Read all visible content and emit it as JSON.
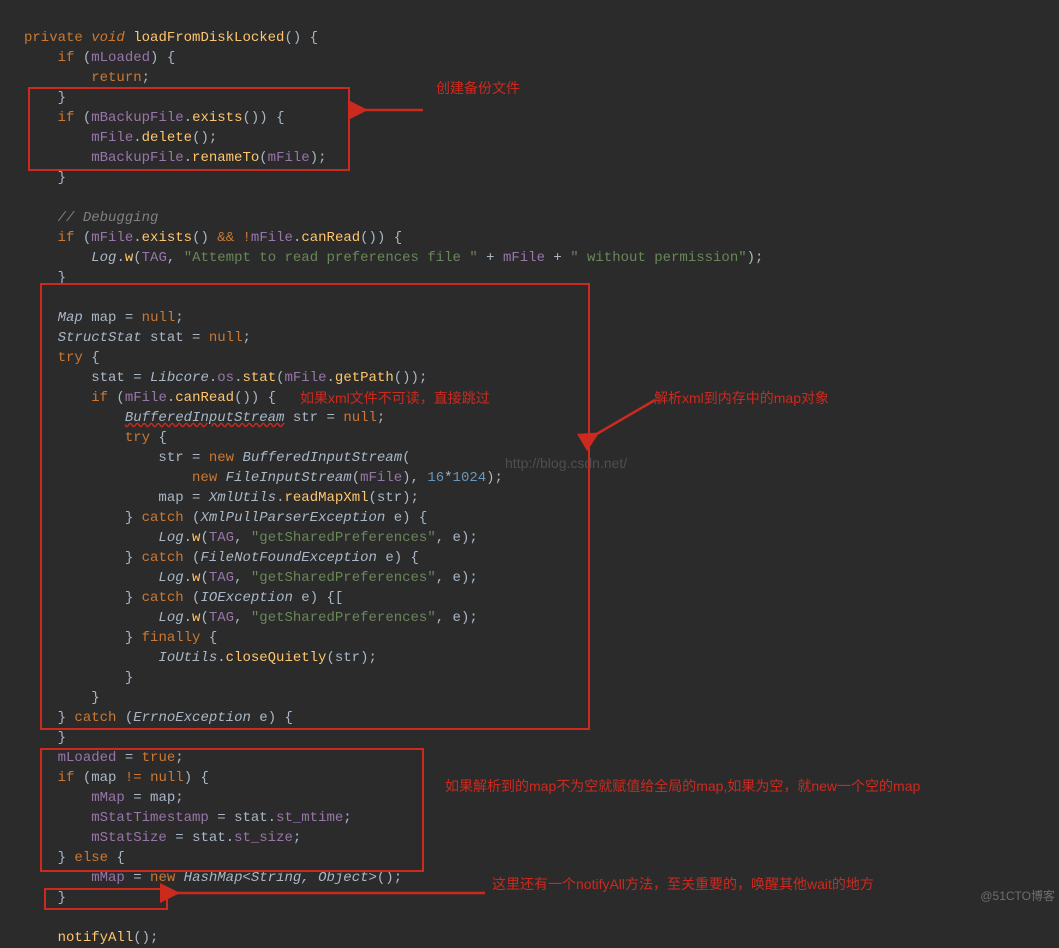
{
  "code": {
    "l01": {
      "kw1": "private",
      "kw2": "void",
      "mth": "loadFromDiskLocked",
      "rest": "() {"
    },
    "l02": {
      "kw": "if",
      "fld": "mLoaded",
      "rest1": " (",
      "rest2": ") {"
    },
    "l03": {
      "kw": "return",
      "rest": ";"
    },
    "l04": {
      "rest": "}"
    },
    "l05": {
      "kw": "if",
      "fld": "mBackupFile",
      "mth": "exists",
      "rest1": " (",
      "rest2": ".",
      "rest3": "()) {"
    },
    "l06": {
      "fld": "mFile",
      "mth": "delete",
      "rest1": ".",
      "rest2": "();"
    },
    "l07": {
      "fld": "mBackupFile",
      "mth": "renameTo",
      "fld2": "mFile",
      "r1": ".",
      "r2": "(",
      "r3": ");"
    },
    "l08": {
      "rest": "}"
    },
    "l09": "",
    "l10": {
      "com": "// Debugging"
    },
    "l11": {
      "kw": "if",
      "fld1": "mFile",
      "mth1": "exists",
      "op": "&&",
      "not": "!",
      "fld2": "mFile",
      "mth2": "canRead",
      "r1": " (",
      "r2": ".",
      "r3": "() ",
      "r4": ".",
      "r5": "()) {"
    },
    "l12": {
      "cls": "Log",
      "mth": "w",
      "fld": "TAG",
      "str1": "\"Attempt to read preferences file \"",
      "fld2": "mFile",
      "str2": "\" without permission\"",
      "r1": ".",
      "r2": "(",
      "r3": ", ",
      "r4": " + ",
      "r5": " + ",
      "r6": ");"
    },
    "l13": {
      "rest": "}"
    },
    "l14": "",
    "l15": {
      "cls": "Map",
      "var": "map",
      "op": "= ",
      "null": "null",
      "rest": ";"
    },
    "l16": {
      "cls": "StructStat",
      "var": "stat",
      "op": "= ",
      "null": "null",
      "rest": ";"
    },
    "l17": {
      "kw": "try",
      "rest": " {"
    },
    "l18": {
      "var": "stat",
      "op": " = ",
      "cls": "Libcore",
      "fld": "os",
      "mth1": "stat",
      "fld2": "mFile",
      "mth2": "getPath",
      "r1": ".",
      "r2": ".",
      "r3": "(",
      "r4": ".",
      "r5": "());"
    },
    "l19": {
      "kw": "if",
      "fld": "mFile",
      "mth": "canRead",
      "r1": " (",
      "r2": ".",
      "r3": "()) {"
    },
    "l20": {
      "cls": "BufferedInputStream",
      "var": "str",
      "op": " = ",
      "null": "null",
      "rest": ";"
    },
    "l21": {
      "kw": "try",
      "rest": " {"
    },
    "l22": {
      "var": "str",
      "op": " = ",
      "kw": "new",
      "cls": "BufferedInputStream",
      "rest": "("
    },
    "l23": {
      "kw": "new",
      "cls": "FileInputStream",
      "fld": "mFile",
      "num1": "16",
      "num2": "1024",
      "r1": "(",
      "r2": "), ",
      "r3": "*",
      "r4": ");"
    },
    "l24": {
      "var": "map",
      "op": " = ",
      "cls": "XmlUtils",
      "mth": "readMapXml",
      "var2": "str",
      "r1": ".",
      "r2": "(",
      "r3": ");"
    },
    "l25": {
      "rest1": "} ",
      "kw": "catch",
      "cls": "XmlPullParserException",
      "var": "e",
      "r1": " (",
      "r2": " ",
      "r3": ") {"
    },
    "l26": {
      "cls": "Log",
      "mth": "w",
      "fld": "TAG",
      "str": "\"getSharedPreferences\"",
      "var": "e",
      "r1": ".",
      "r2": "(",
      "r3": ", ",
      "r4": ", ",
      "r5": ");"
    },
    "l27": {
      "rest1": "} ",
      "kw": "catch",
      "cls": "FileNotFoundException",
      "var": "e",
      "r1": " (",
      "r2": " ",
      "r3": ") {"
    },
    "l28": {
      "cls": "Log",
      "mth": "w",
      "fld": "TAG",
      "str": "\"getSharedPreferences\"",
      "var": "e",
      "r1": ".",
      "r2": "(",
      "r3": ", ",
      "r4": ", ",
      "r5": ");"
    },
    "l29": {
      "rest1": "} ",
      "kw": "catch",
      "cls": "IOException",
      "var": "e",
      "r1": " (",
      "r2": " ",
      "r3": ") {"
    },
    "l30": {
      "cls": "Log",
      "mth": "w",
      "fld": "TAG",
      "str": "\"getSharedPreferences\"",
      "var": "e",
      "r1": ".",
      "r2": "(",
      "r3": ", ",
      "r4": ", ",
      "r5": ");"
    },
    "l31": {
      "rest1": "} ",
      "kw": "finally",
      "rest2": " {"
    },
    "l32": {
      "cls": "IoUtils",
      "mth": "closeQuietly",
      "var": "str",
      "r1": ".",
      "r2": "(",
      "r3": ");"
    },
    "l33": {
      "rest": "}"
    },
    "l34": {
      "rest": "}"
    },
    "l35": {
      "rest1": "} ",
      "kw": "catch",
      "cls": "ErrnoException",
      "var": "e",
      "r1": " (",
      "r2": " ",
      "r3": ") {"
    },
    "l36": {
      "rest": "}"
    },
    "l37": {
      "fld": "mLoaded",
      "op": " = ",
      "bool": "true",
      "rest": ";"
    },
    "l38": {
      "kw": "if",
      "var": "map",
      "op": "!=",
      "null": "null",
      "r1": " (",
      "r2": " ",
      "r3": " ",
      "r4": ") {"
    },
    "l39": {
      "fld": "mMap",
      "op": " = ",
      "var": "map",
      "rest": ";"
    },
    "l40": {
      "fld": "mStatTimestamp",
      "op": " = ",
      "var": "stat",
      "fld2": "st_mtime",
      "r1": ".",
      "rest": ";"
    },
    "l41": {
      "fld": "mStatSize",
      "op": " = ",
      "var": "stat",
      "fld2": "st_size",
      "r1": ".",
      "rest": ";"
    },
    "l42": {
      "rest1": "} ",
      "kw": "else",
      "rest2": " {"
    },
    "l43": {
      "fld": "mMap",
      "op": " = ",
      "kw": "new",
      "cls": "HashMap<String, Object>",
      "rest": "();"
    },
    "l44": {
      "rest": "}"
    },
    "l45": "",
    "l46": {
      "mth": "notifyAll",
      "rest": "();"
    }
  },
  "annot": {
    "a1": "创建备份文件",
    "a2": "如果xml文件不可读，直接跳过",
    "a3": "解析xml到内存中的map对象",
    "a4": "如果解析到的map不为空就赋值给全局的map,如果为空，就new一个空的map",
    "a5": "这里还有一个notifyAll方法，至关重要的，唤醒其他wait的地方"
  },
  "watermark": {
    "center": "http://blog.csdn.net/",
    "right": "@51CTO博客"
  },
  "l29bracket": "["
}
